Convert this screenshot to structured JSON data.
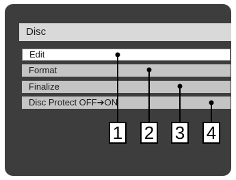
{
  "menu": {
    "title": "Disc",
    "items": [
      {
        "label": "Edit",
        "selected": true
      },
      {
        "label": "Format",
        "selected": false
      },
      {
        "label": "Finalize",
        "selected": false
      },
      {
        "label_before": "Disc Protect OFF",
        "arrow": "➔",
        "label_after": "ON",
        "selected": false
      }
    ]
  },
  "callouts": [
    "1",
    "2",
    "3",
    "4"
  ],
  "colors": {
    "screen_background": "#3d3d3d",
    "title_bar": "#d9d9d9",
    "item_background": "#c4c4c4",
    "selected_item_background": "#ffffff",
    "callout_line": "#000000"
  }
}
